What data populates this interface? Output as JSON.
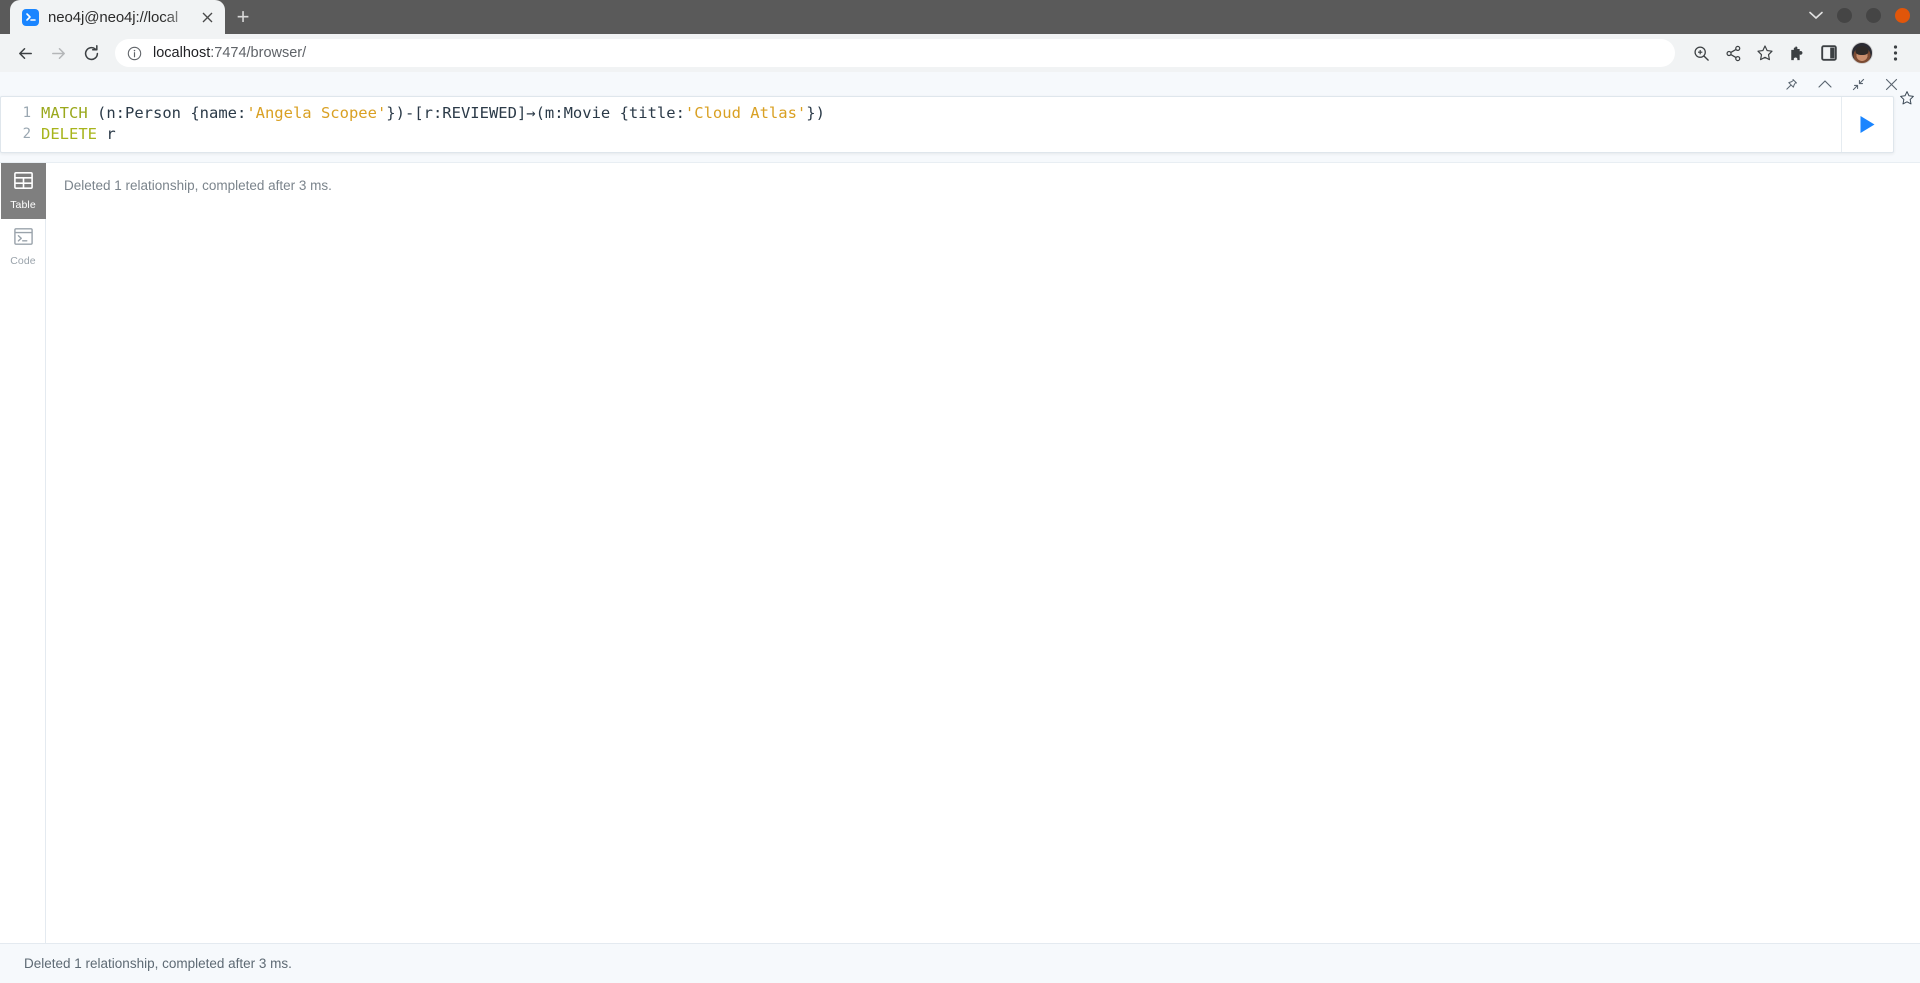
{
  "browser": {
    "tab": {
      "title": "neo4j@neo4j://local",
      "favicon_icon": "terminal-icon",
      "close_icon": "close-icon"
    },
    "new_tab_label": "+",
    "window_controls": {
      "chevron_icon": "chevron-down-icon",
      "minimize_color": "#454545",
      "maximize_color": "#454545",
      "close_color": "#e1560a"
    },
    "nav": {
      "back_icon": "back-arrow-icon",
      "forward_icon": "forward-arrow-icon",
      "reload_icon": "reload-icon"
    },
    "omnibox": {
      "info_icon": "info-circle-icon",
      "url_host": "localhost",
      "url_path": ":7474/browser/"
    },
    "toolbar_icons": [
      {
        "name": "zoom-in-icon"
      },
      {
        "name": "share-icon"
      },
      {
        "name": "bookmark-star-icon"
      },
      {
        "name": "extensions-puzzle-icon"
      },
      {
        "name": "side-panel-icon"
      },
      {
        "name": "profile-avatar"
      },
      {
        "name": "more-menu-icon"
      }
    ]
  },
  "editor": {
    "toolbar": [
      {
        "name": "pin-icon"
      },
      {
        "name": "chevron-up-icon"
      },
      {
        "name": "contract-icon"
      },
      {
        "name": "close-icon"
      }
    ],
    "lines": [
      {
        "number": "1"
      },
      {
        "number": "2"
      }
    ],
    "line1": {
      "kw": "MATCH",
      "seg1": " (n:Person {name:",
      "str1": "'Angela Scopee'",
      "seg2": "})-[r:REVIEWED]→(m:Movie {title:",
      "str2": "'Cloud Atlas'",
      "seg3": "})"
    },
    "line2": {
      "kw": "DELETE",
      "seg1": " r"
    },
    "run_button_icon": "play-icon",
    "favorite_icon": "star-outline-icon",
    "accent_color": "#1a85ff",
    "keyword_color": "#9aa81c",
    "string_color": "#d9a023"
  },
  "frame": {
    "sidebar": [
      {
        "label": "Table",
        "icon": "table-icon",
        "active": true
      },
      {
        "label": "Code",
        "icon": "code-terminal-icon",
        "active": false
      }
    ],
    "result_message": "Deleted 1 relationship, completed after 3 ms."
  },
  "statusbar": {
    "message": "Deleted 1 relationship, completed after 3 ms."
  }
}
